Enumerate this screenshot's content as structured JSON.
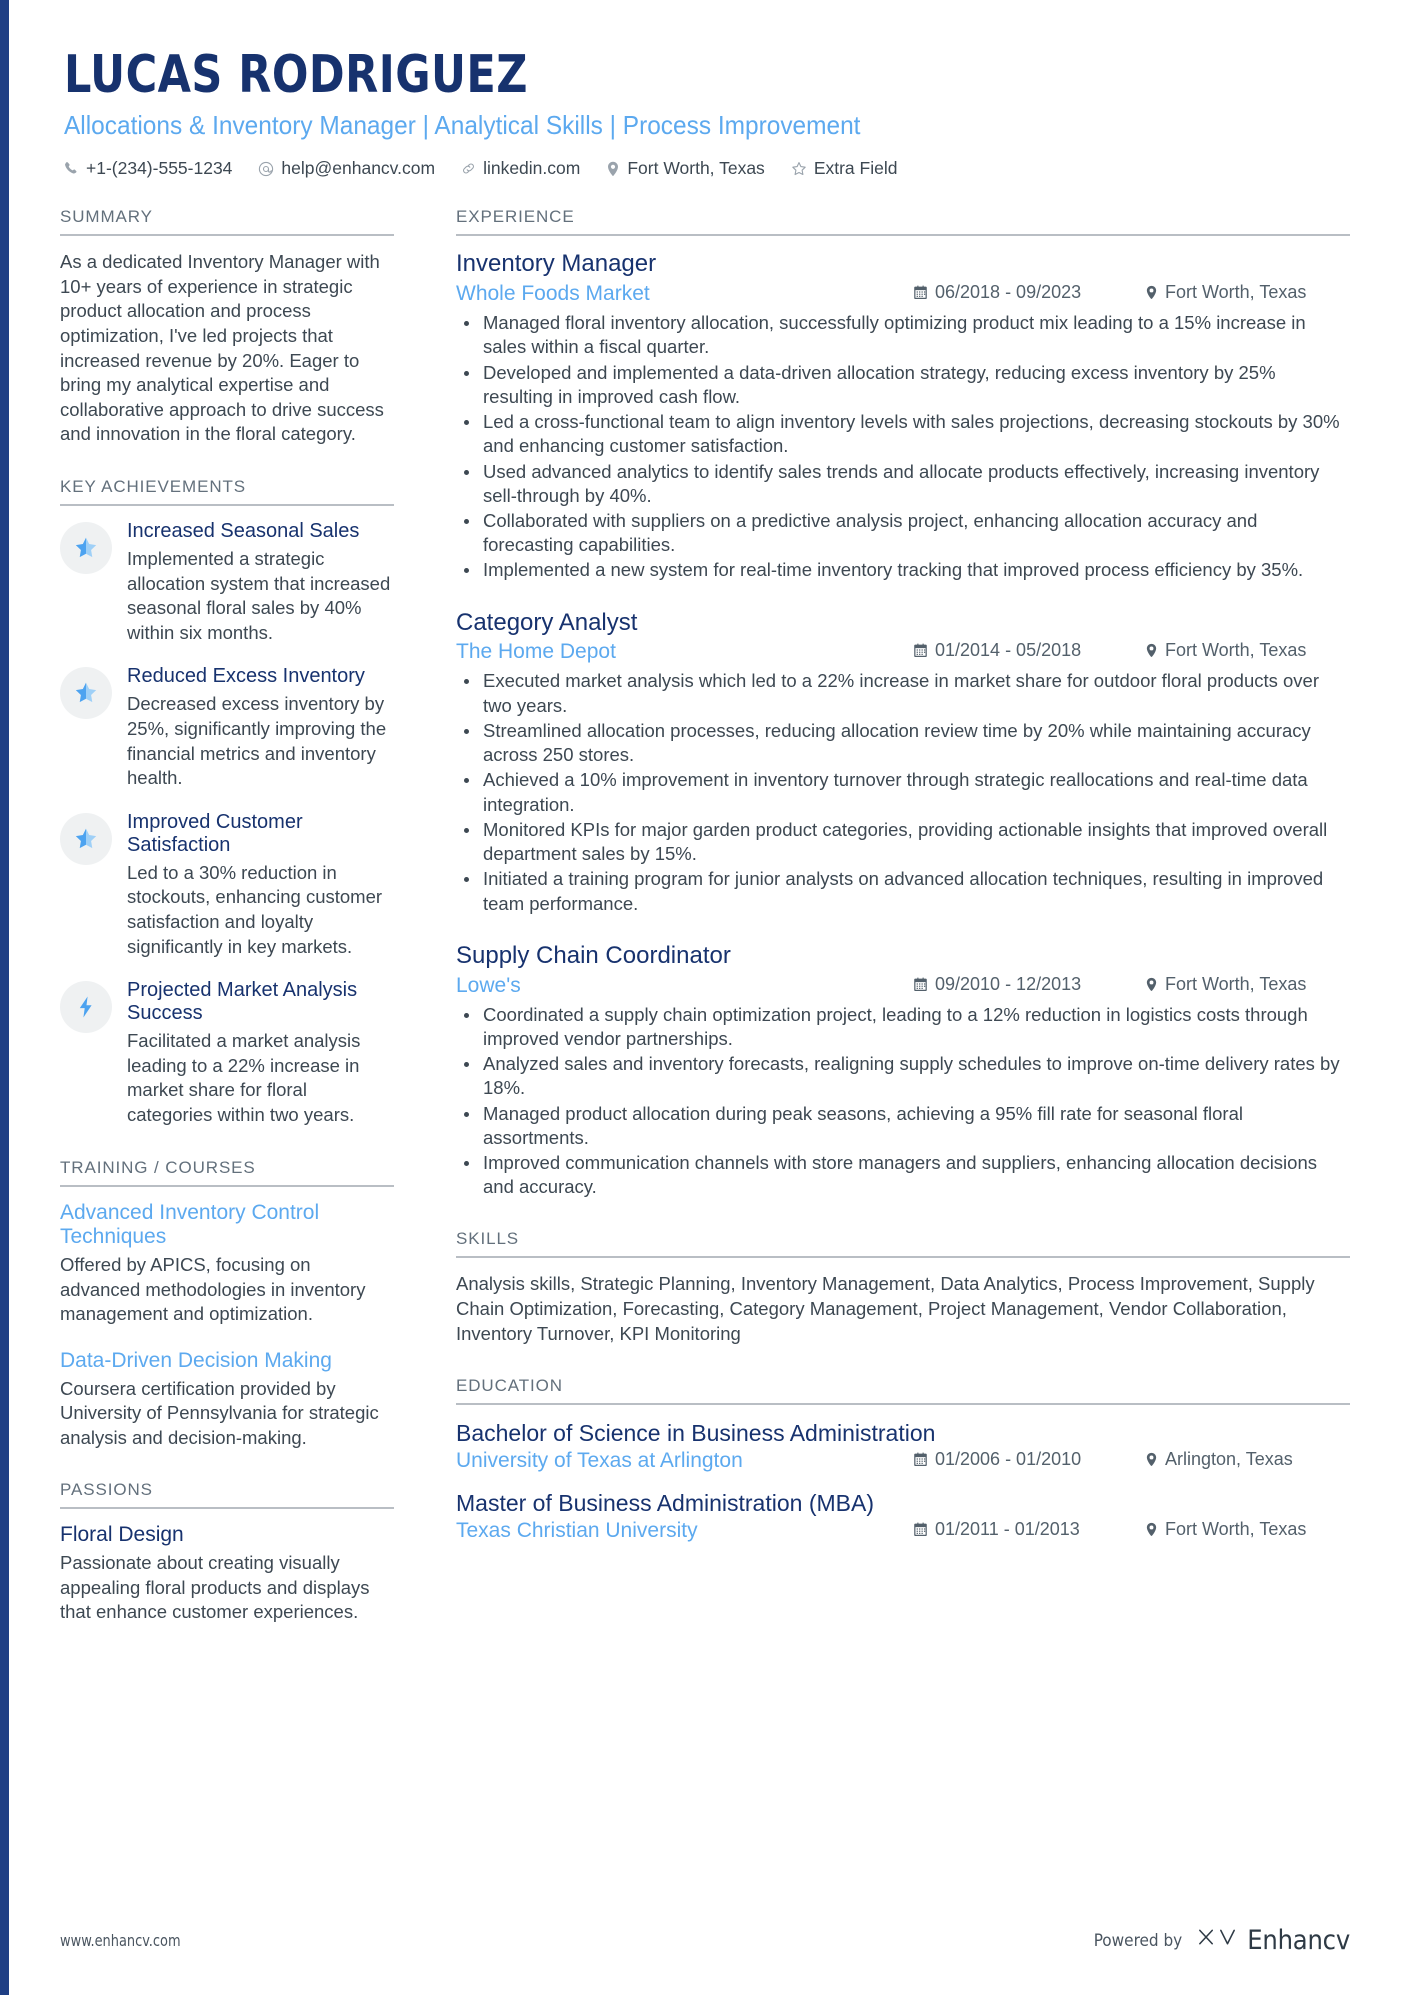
{
  "colors": {
    "accent_dark_blue": "#17326e",
    "accent_light_blue": "#5ca9ef",
    "body_text": "#3d4852",
    "section_head": "#63707c",
    "sidebar_bar": "#1f3f85"
  },
  "header": {
    "name": "LUCAS RODRIGUEZ",
    "headline": "Allocations & Inventory Manager | Analytical Skills | Process Improvement",
    "contacts": [
      {
        "icon": "phone-icon",
        "text": "+1-(234)-555-1234"
      },
      {
        "icon": "email-icon",
        "text": "help@enhancv.com"
      },
      {
        "icon": "link-icon",
        "text": "linkedin.com"
      },
      {
        "icon": "location-icon",
        "text": "Fort Worth, Texas"
      },
      {
        "icon": "star-icon",
        "text": "Extra Field"
      }
    ]
  },
  "summary": {
    "heading": "SUMMARY",
    "text": "As a dedicated Inventory Manager with 10+ years of experience in strategic product allocation and process optimization, I've led projects that increased revenue by 20%. Eager to bring my analytical expertise and collaborative approach to drive success and innovation in the floral category."
  },
  "key_achievements": {
    "heading": "KEY ACHIEVEMENTS",
    "items": [
      {
        "icon": "half-star-icon",
        "title": "Increased Seasonal Sales",
        "description": "Implemented a strategic allocation system that increased seasonal floral sales by 40% within six months."
      },
      {
        "icon": "half-star-icon",
        "title": "Reduced Excess Inventory",
        "description": "Decreased excess inventory by 25%, significantly improving the financial metrics and inventory health."
      },
      {
        "icon": "half-star-icon",
        "title": "Improved Customer Satisfaction",
        "description": "Led to a 30% reduction in stockouts, enhancing customer satisfaction and loyalty significantly in key markets."
      },
      {
        "icon": "lightning-bolt-icon",
        "title": "Projected Market Analysis Success",
        "description": "Facilitated a market analysis leading to a 22% increase in market share for floral categories within two years."
      }
    ]
  },
  "training": {
    "heading": "TRAINING / COURSES",
    "items": [
      {
        "title": "Advanced Inventory Control Techniques",
        "description": "Offered by APICS, focusing on advanced methodologies in inventory management and optimization."
      },
      {
        "title": "Data-Driven Decision Making",
        "description": "Coursera certification provided by University of Pennsylvania for strategic analysis and decision-making."
      }
    ]
  },
  "passions": {
    "heading": "PASSIONS",
    "items": [
      {
        "title": "Floral Design",
        "description": "Passionate about creating visually appealing floral products and displays that enhance customer experiences."
      }
    ]
  },
  "experience": {
    "heading": "EXPERIENCE",
    "jobs": [
      {
        "title": "Inventory Manager",
        "company": "Whole Foods Market",
        "dates": "06/2018 - 09/2023",
        "location": "Fort Worth, Texas",
        "bullets": [
          "Managed floral inventory allocation, successfully optimizing product mix leading to a 15% increase in sales within a fiscal quarter.",
          "Developed and implemented a data-driven allocation strategy, reducing excess inventory by 25% resulting in improved cash flow.",
          "Led a cross-functional team to align inventory levels with sales projections, decreasing stockouts by 30% and enhancing customer satisfaction.",
          "Used advanced analytics to identify sales trends and allocate products effectively, increasing inventory sell-through by 40%.",
          "Collaborated with suppliers on a predictive analysis project, enhancing allocation accuracy and forecasting capabilities.",
          "Implemented a new system for real-time inventory tracking that improved process efficiency by 35%."
        ]
      },
      {
        "title": "Category Analyst",
        "company": "The Home Depot",
        "dates": "01/2014 - 05/2018",
        "location": "Fort Worth, Texas",
        "bullets": [
          "Executed market analysis which led to a 22% increase in market share for outdoor floral products over two years.",
          "Streamlined allocation processes, reducing allocation review time by 20% while maintaining accuracy across 250 stores.",
          "Achieved a 10% improvement in inventory turnover through strategic reallocations and real-time data integration.",
          "Monitored KPIs for major garden product categories, providing actionable insights that improved overall department sales by 15%.",
          "Initiated a training program for junior analysts on advanced allocation techniques, resulting in improved team performance."
        ]
      },
      {
        "title": "Supply Chain Coordinator",
        "company": "Lowe's",
        "dates": "09/2010 - 12/2013",
        "location": "Fort Worth, Texas",
        "bullets": [
          "Coordinated a supply chain optimization project, leading to a 12% reduction in logistics costs through improved vendor partnerships.",
          "Analyzed sales and inventory forecasts, realigning supply schedules to improve on-time delivery rates by 18%.",
          "Managed product allocation during peak seasons, achieving a 95% fill rate for seasonal floral assortments.",
          "Improved communication channels with store managers and suppliers, enhancing allocation decisions and accuracy."
        ]
      }
    ]
  },
  "skills": {
    "heading": "SKILLS",
    "text": "Analysis skills, Strategic Planning, Inventory Management, Data Analytics, Process Improvement, Supply Chain Optimization, Forecasting, Category Management, Project Management, Vendor Collaboration, Inventory Turnover, KPI Monitoring"
  },
  "education": {
    "heading": "EDUCATION",
    "items": [
      {
        "degree": "Bachelor of Science in Business Administration",
        "school": "University of Texas at Arlington",
        "dates": "01/2006 - 01/2010",
        "location": "Arlington, Texas"
      },
      {
        "degree": "Master of Business Administration (MBA)",
        "school": "Texas Christian University",
        "dates": "01/2011 - 01/2013",
        "location": "Fort Worth, Texas"
      }
    ]
  },
  "footer": {
    "url": "www.enhancv.com",
    "powered_by": "Powered by",
    "brand": "Enhancv"
  }
}
